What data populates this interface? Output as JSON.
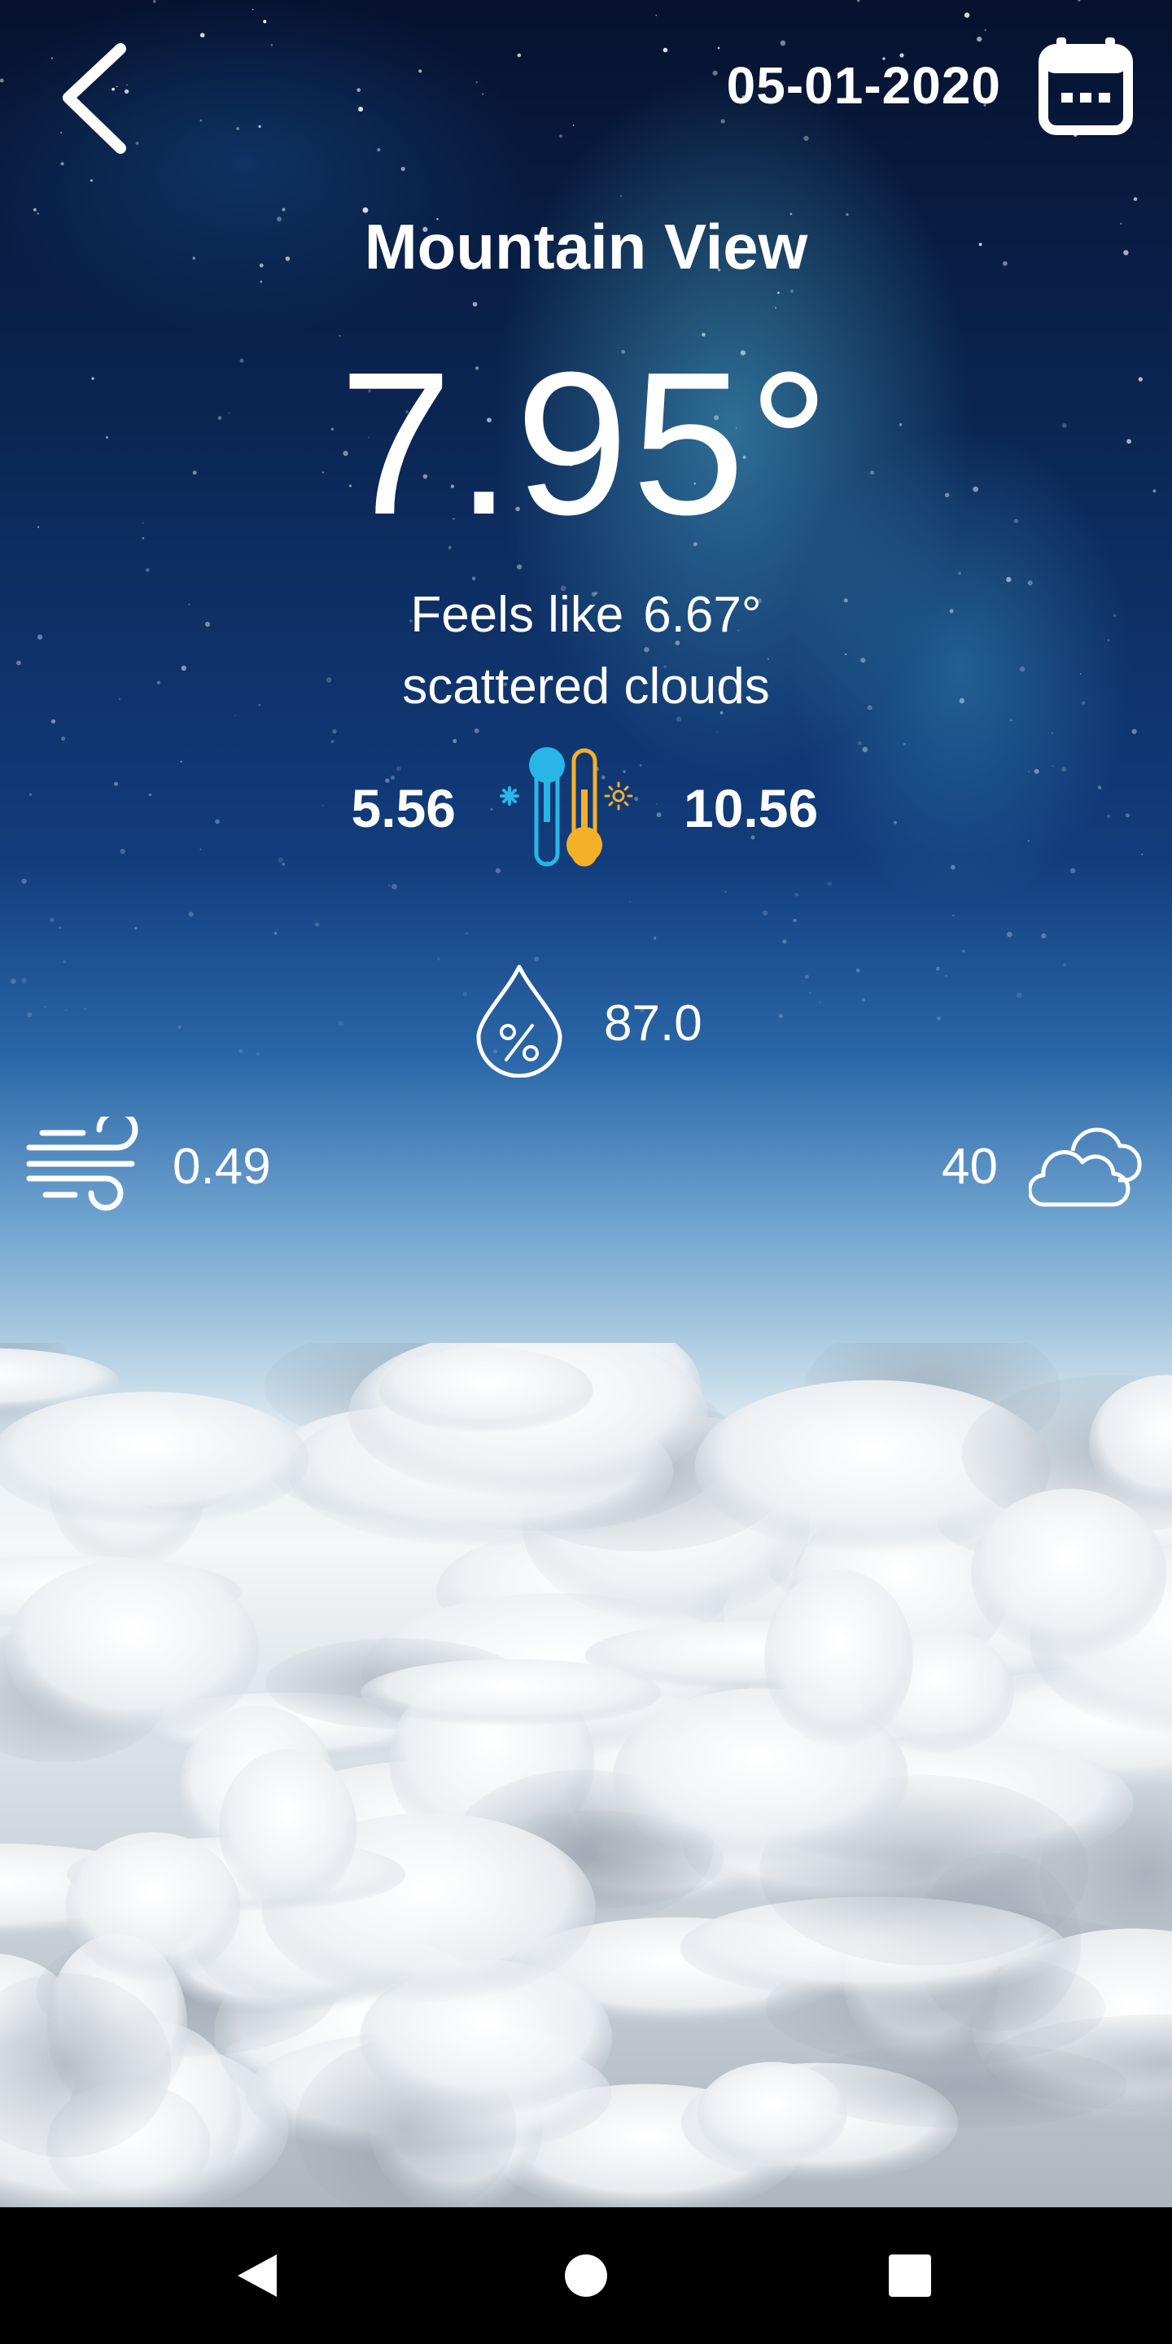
{
  "header": {
    "back_icon": "chevron-left-icon",
    "date": "05-01-2020",
    "calendar_icon": "calendar-icon"
  },
  "weather": {
    "city": "Mountain View",
    "temperature": "7.95°",
    "feels_like_label": "Feels like",
    "feels_like_value": "6.67°",
    "description": "scattered clouds",
    "temp_min": "5.56",
    "temp_max": "10.56",
    "thermometer_icon": "thermometer-icon",
    "humidity_icon": "humidity-icon",
    "humidity": "87.0",
    "wind_icon": "wind-icon",
    "wind_speed": "0.49",
    "clouds_icon": "clouds-icon",
    "cloudiness": "40"
  },
  "colors": {
    "text": "#ffffff",
    "thermo_cold": "#29b6e6",
    "thermo_hot": "#f5b02a",
    "navbar": "#000000"
  },
  "navbar": {
    "back_icon": "nav-back-icon",
    "home_icon": "nav-home-icon",
    "recents_icon": "nav-recents-icon"
  }
}
